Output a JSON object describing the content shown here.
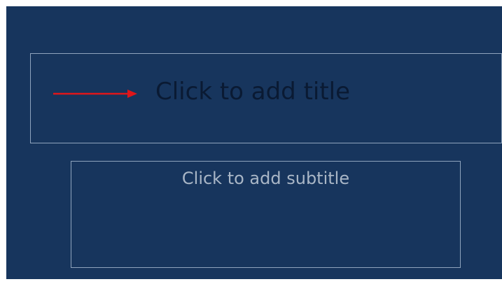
{
  "slide": {
    "title_placeholder": "Click to add title",
    "subtitle_placeholder": "Click to add subtitle",
    "arrow_icon": "right-arrow-icon",
    "colors": {
      "slide_background": "#17355d",
      "title_text": "#0a1a33",
      "subtitle_text": "#a9b6c6",
      "placeholder_border": "#8fa4bd",
      "arrow": "#e0161a"
    }
  }
}
